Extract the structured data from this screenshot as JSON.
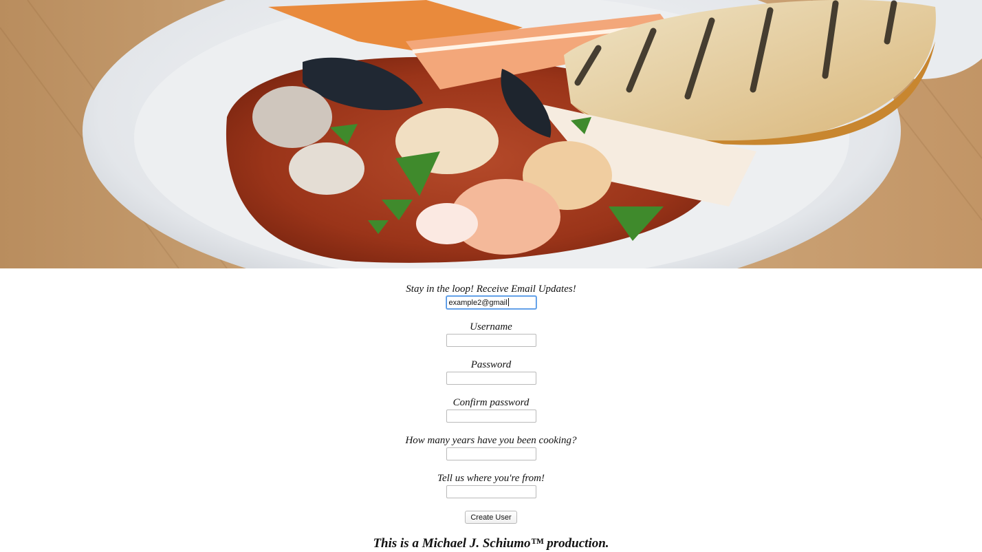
{
  "hero": {
    "image_description_icon": "seafood-stew-photo"
  },
  "form": {
    "email_label": "Stay in the loop! Receive Email Updates!",
    "email_value": "example2@gmail",
    "username_label": "Username",
    "username_value": "",
    "password_label": "Password",
    "password_value": "",
    "confirm_label": "Confirm password",
    "confirm_value": "",
    "years_label": "How many years have you been cooking?",
    "years_value": "",
    "location_label": "Tell us where you're from!",
    "location_value": "",
    "submit_label": "Create User"
  },
  "footer": {
    "credit": "This is a Michael J. Schiumo™ production."
  },
  "colors": {
    "focus_ring": "#4a90e2",
    "sauce": "#a0381f",
    "plate": "#eef0f2",
    "table_wood": "#c9a070"
  }
}
